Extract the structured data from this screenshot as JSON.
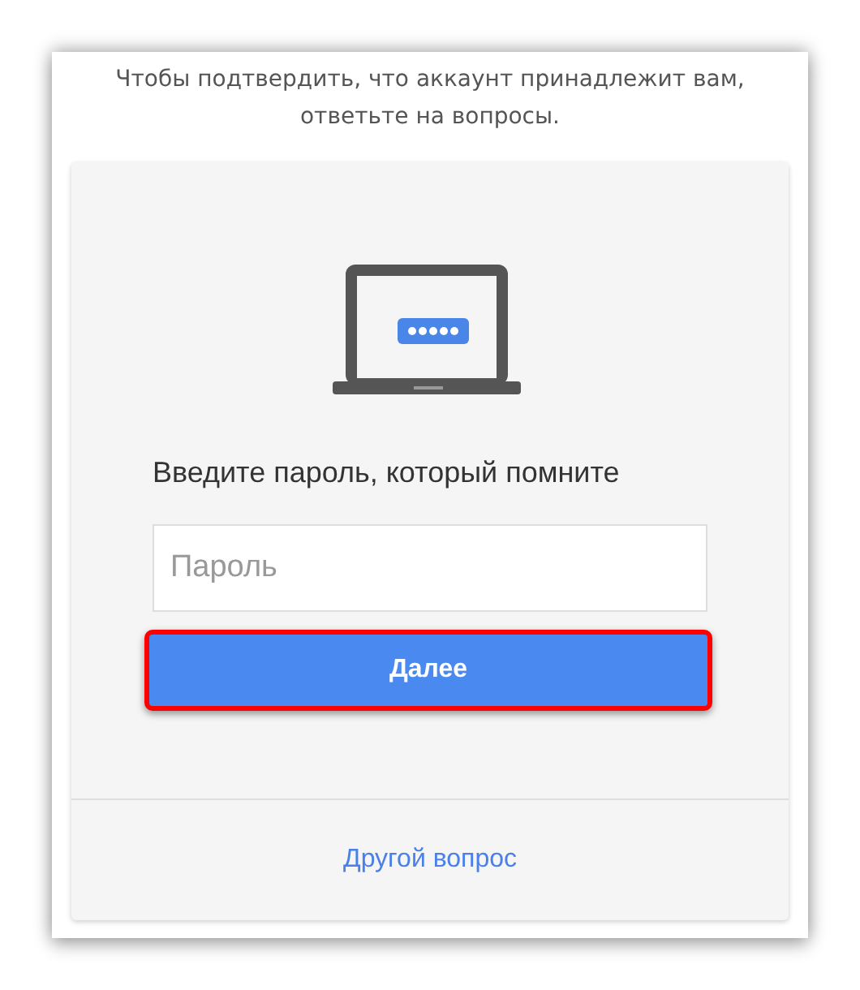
{
  "intro": "Чтобы подтвердить, что аккаунт принадлежит вам,\nответьте на вопросы.",
  "prompt": "Введите пароль, который помните",
  "password_field": {
    "placeholder": "Пароль"
  },
  "next_button": {
    "label": "Далее",
    "highlighted": true
  },
  "other_question_link": "Другой вопрос"
}
